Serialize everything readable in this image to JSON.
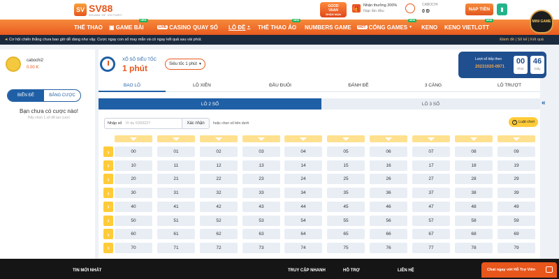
{
  "header": {
    "brand": "SV88",
    "brand_mark": "SV",
    "brand_sub": "SOUND OF VICTORY",
    "promo1_line1": "GOOD",
    "promo1_line2": "VAAN",
    "promo1_line3": "NHẬN MẠN",
    "promo2_title": "Nhận thưởng 200%",
    "promo2_sub": "Nạp lần đầu",
    "user_label": "CABOCHI",
    "user_balance": "0 Đ",
    "deposit_label": "NẠP TIỀN",
    "minigame_label": "MINI GAME"
  },
  "nav": {
    "items": [
      "THỂ THAO",
      "GAME BÀI",
      "CASINO",
      "QUAY SỐ",
      "LÔ ĐỀ",
      "THỂ THAO ẢO",
      "NUMBERS GAME",
      "CỔNG GAMES",
      "KENO",
      "KENO VIETLOTT"
    ],
    "live_tag": "LIVE",
    "hot_tag": "HOT",
    "new_tag": "NEW"
  },
  "ticker": {
    "message": "Cơ hội chiến thắng chưa bao giờ dễ dàng như vậy. Cược ngay con số may mắn và có ngay kết quả sau vài phút.",
    "links": "Đánh đề | Sổ kế | Kết quả"
  },
  "left": {
    "username": "cabochi2",
    "balance": "0.00 K",
    "tab_slip": "BIỂN ĐỀ",
    "tab_table": "BẢNG CƯỢC",
    "empty_title": "Bạn chưa có cược nào!",
    "empty_sub": "Hãy chọn 1 số để tạo cược"
  },
  "lottery": {
    "title": "XỔ SỐ SIÊU TỐC",
    "subtitle": "1 phút",
    "speed_select": "Siêu tốc 1 phút",
    "next_label": "Lượt xổ tiếp theo",
    "draw_id": "20231020-0971",
    "minutes": "00",
    "minutes_unit": "Phút",
    "seconds": "46",
    "seconds_unit": "Giây"
  },
  "bet_tabs": [
    "BAO LÔ",
    "LÔ XIÊN",
    "ĐẦU ĐUÔI",
    "ĐÁNH ĐỀ",
    "3 CÀNG",
    "LÔ TRƯỢT"
  ],
  "sub_tabs": [
    "LÔ 2 SỐ",
    "LÔ 3 SỐ"
  ],
  "number_entry": {
    "label": "Nhập số",
    "placeholder": "Ví dụ 6393227",
    "confirm": "Xác nhận",
    "hint": "hoặc chọn số bên dưới",
    "rules": "Luật chơi",
    "rules_icon": "?"
  },
  "grid": {
    "rows": [
      [
        "00",
        "01",
        "02",
        "03",
        "04",
        "05",
        "06",
        "07",
        "08",
        "09"
      ],
      [
        "10",
        "11",
        "12",
        "13",
        "14",
        "15",
        "16",
        "17",
        "18",
        "19"
      ],
      [
        "20",
        "21",
        "22",
        "23",
        "24",
        "25",
        "26",
        "27",
        "28",
        "29"
      ],
      [
        "30",
        "31",
        "32",
        "33",
        "34",
        "35",
        "36",
        "37",
        "38",
        "39"
      ],
      [
        "40",
        "41",
        "42",
        "43",
        "44",
        "45",
        "46",
        "47",
        "48",
        "49"
      ],
      [
        "50",
        "51",
        "52",
        "53",
        "54",
        "55",
        "56",
        "57",
        "58",
        "59"
      ],
      [
        "60",
        "61",
        "62",
        "63",
        "64",
        "65",
        "66",
        "67",
        "68",
        "69"
      ],
      [
        "70",
        "71",
        "72",
        "73",
        "74",
        "75",
        "76",
        "77",
        "78",
        "79"
      ]
    ]
  },
  "footer": {
    "news": "TIN MỚI NHẤT",
    "quick": "TRUY CẬP NHANH",
    "support": "HỖ TRỢ",
    "contact": "LIÊN HỆ"
  },
  "chat": {
    "label": "Chat ngay với Hỗ Trợ Viên"
  },
  "colors": {
    "accent": "#e8561c",
    "primary": "#1f5fa5",
    "highlight": "#ffcb39"
  }
}
